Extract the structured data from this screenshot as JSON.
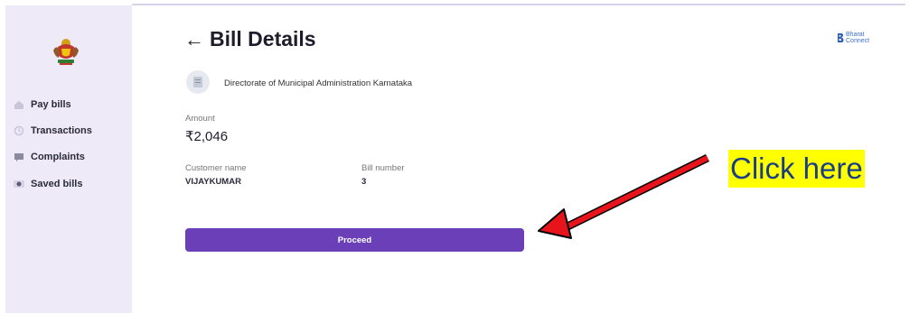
{
  "sidebar": {
    "items": [
      {
        "label": "Pay bills",
        "icon": "home-icon"
      },
      {
        "label": "Transactions",
        "icon": "transactions-icon"
      },
      {
        "label": "Complaints",
        "icon": "complaints-icon"
      },
      {
        "label": "Saved bills",
        "icon": "saved-bills-icon"
      }
    ]
  },
  "header": {
    "title": "Bill Details",
    "brand_line1": "Bharat",
    "brand_line2": "Connect"
  },
  "biller": {
    "name": "Directorate of Municipal Administration Karnataka"
  },
  "bill": {
    "amount_label": "Amount",
    "amount_value": "₹2,046",
    "customer_label": "Customer name",
    "customer_value": "VIJAYKUMAR",
    "bill_number_label": "Bill number",
    "bill_number_value": "3"
  },
  "actions": {
    "proceed_label": "Proceed"
  },
  "annotation": {
    "callout_text": "Click here",
    "arrow_color": "#e8141b",
    "highlight_color": "#ffff00"
  }
}
